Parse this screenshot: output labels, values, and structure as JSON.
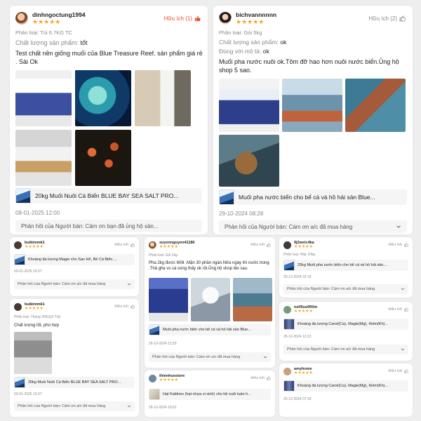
{
  "colors": {
    "star": "#f5a623",
    "helpful_active": "#ee4d2d",
    "muted": "#888888",
    "background": "#eeeeee"
  },
  "icons": {
    "helpful": "thumb-up-icon",
    "expand": "chevron-down-icon"
  },
  "reviews": [
    {
      "user": "dinhngoctung1994",
      "stars": "★★★★★",
      "helpful": "Hữu ích (1)",
      "helpful_active": true,
      "variant": "Phân loại: Túi 6.7KG TC",
      "quality_label": "Chất lượng sản phẩm:",
      "quality_value": "tốt",
      "comment": "Test chất nền giống muối của Blue Treasure Reef. sản phẩm giá rẻ . Sài Ok",
      "product": "20kg Muối Nuôi Cá Biển BLUE BAY SEA SALT PRO...",
      "date": "08-01-2025 12:00",
      "reply": "Phản hồi của Người bán: Cám ơn bạn đã ủng hộ sản..."
    },
    {
      "user": "bichvannnnnn",
      "stars": "★★★★★",
      "helpful": "Hữu ích (2)",
      "helpful_active": false,
      "variant": "Phân loại: Gói 5kg",
      "quality_label": "Chất lượng sản phẩm:",
      "quality_value": "ok",
      "match_label": "Đúng với mô tả:",
      "match_value": "ok",
      "comment": "Muối pha nước nuôi ok.Tôm đỡ hao hơn nuôi nước biển.Ủng hộ shop 5 sao.",
      "product": "Muối pha nước biển cho bể cá và hồ hải sản Blue...",
      "date": "29-10-2024 08:28",
      "reply": "Phản hồi của Người bán: Cám ơn a/c đã mua hàng"
    },
    {
      "user": "buikimmk1",
      "stars": "★★★★★",
      "helpful": "Hữu ích",
      "product": "Khoáng đa lượng Magie cho San Hô, Bể Cá Biển ...",
      "date": "03-01-2025 15:07",
      "reply": "Phản hồi của Người bán: Cám ơn a/c đã mua hàng"
    },
    {
      "user": "buikimmk1",
      "stars": "★★★★★",
      "helpful": "Hữu ích",
      "variant": "Phân loại: Thùng 20KG(3 Túi)",
      "comment": "Chất lượng tốt, phù hợp",
      "product": "20kg Muối Nuôi Cá Biển BLUE BAY SEA SALT PRO...",
      "date": "03-01-2025 15:07",
      "reply": "Phản hồi của Người bán: Cám ơn a/c đã mua hàng"
    },
    {
      "user": "xuyennguyen41186",
      "stars": "★★★★★",
      "helpful": "Hữu ích",
      "variant": "Phân loại: Gói 2kg",
      "comment": "Pha 2kg được 60lit .Mặn 30 phần ngàn.Nửa ngày thì nước trong .Thả ghẹ vs cá song thấy ok rồi.Ủng hộ shop lần sau.",
      "product": "Muối pha nước biển cho bể cá và hồ hải sản Blue...",
      "date": "26-10-2024 21:59",
      "reply": "Phản hồi của Người bán: Cám ơn a/c đã mua hàng"
    },
    {
      "user": "thienhuestore",
      "stars": "★★★★★",
      "helpful": "Hữu ích",
      "product": "Hạt Kaldnes (hạt nhựa vi sinh) cho hệ nuôi tuần h...",
      "date": "26-10-2024 20:52"
    },
    {
      "user": "9j2wxic4ka",
      "stars": "★★★★★",
      "helpful": "Hữu ích",
      "variant": "Phân loại: Hộp 10kg",
      "product": "20kg Muối pha nước biển cho bể cá và hồ hải sản...",
      "date": "26-12-2024 22:19",
      "reply": "Phản hồi của Người bán: Cám ơn a/c đã mua hàng"
    },
    {
      "user": "neil5uo000m",
      "stars": "★★★★★",
      "helpful": "Hữu ích",
      "product": "Khoáng đa lượng Canxi(Ca), Magie(Mg), Kiềm(Kh)...",
      "date": "25-12-2024 12:22",
      "reply": "Phản hồi của Người bán: Cám ơn a/c đã mua hàng"
    },
    {
      "user": "amyhome",
      "stars": "★★★★★",
      "helpful": "Hữu ích",
      "product": "Khoáng đa lượng Canxi(Ca), Magie(Mg), Kiềm(Kh)...",
      "date": "25-12-2024 07:18"
    }
  ]
}
